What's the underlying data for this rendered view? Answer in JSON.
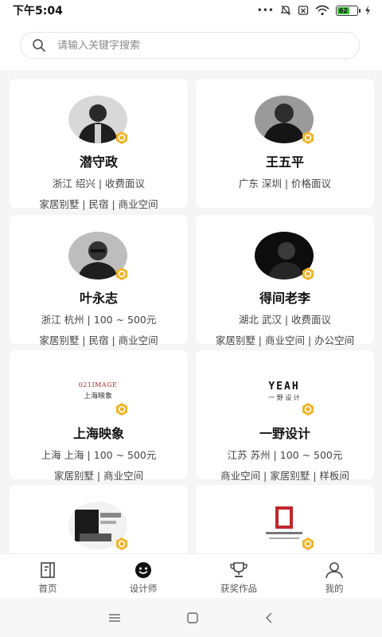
{
  "status": {
    "time": "下午5:04",
    "battery": "62"
  },
  "search": {
    "placeholder": "请输入关键字搜索"
  },
  "designers": [
    {
      "name": "潜守政",
      "location": "浙江 绍兴 | 收费面议",
      "categories": "家居别墅 | 民宿 | 商业空间",
      "avatar": "photo-dark-man"
    },
    {
      "name": "王五平",
      "location": "广东 深圳 | 价格面议",
      "categories": "",
      "avatar": "photo-man"
    },
    {
      "name": "叶永志",
      "location": "浙江 杭州 | 100 ~ 500元",
      "categories": "家居别墅 | 民宿 | 商业空间",
      "avatar": "photo-glasses-man"
    },
    {
      "name": "得间老李",
      "location": "湖北 武汉 | 收费面议",
      "categories": "家居别墅 | 商业空间 | 办公空间",
      "avatar": "photo-dark"
    },
    {
      "name": "上海映象",
      "location": "上海 上海 | 100 ~ 500元",
      "categories": "家居别墅 | 商业空间",
      "avatar": "logo",
      "logo_top": "021IMAGE",
      "logo_bottom": "上海映象"
    },
    {
      "name": "一野设计",
      "location": "江苏 苏州 | 100 ~ 500元",
      "categories": "商业空间 | 家居别墅 | 样板间",
      "avatar": "logo",
      "logo_top": "YEAH",
      "logo_bottom": "一 野 设 计"
    },
    {
      "name": "",
      "location": "",
      "categories": "",
      "avatar": "photo-collage"
    },
    {
      "name": "",
      "location": "",
      "categories": "",
      "avatar": "logo-red"
    }
  ],
  "tabs": [
    {
      "label": "首页",
      "icon": "home-icon"
    },
    {
      "label": "设计师",
      "icon": "smiley-icon"
    },
    {
      "label": "获奖作品",
      "icon": "trophy-icon"
    },
    {
      "label": "我的",
      "icon": "user-icon"
    }
  ],
  "colors": {
    "badge": "#f0b429",
    "accent": "#111111"
  }
}
